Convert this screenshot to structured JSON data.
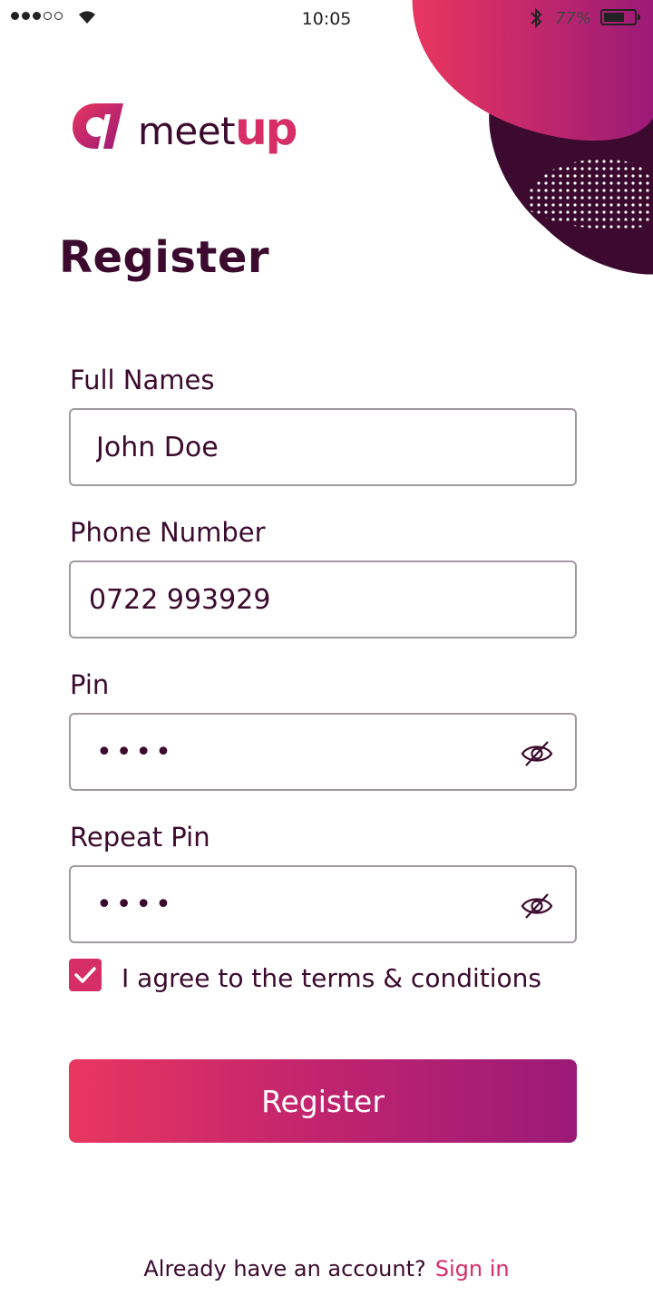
{
  "status_bar": {
    "time": "10:05",
    "battery_percent": "77%",
    "battery_level": 0.77,
    "signal_bars_filled": 3,
    "signal_bars_total": 5
  },
  "brand": {
    "name_part1": "meet",
    "name_part2": "up",
    "colors": {
      "primary": "#d62e67",
      "dark": "#3b0a2e",
      "gradient_start": "#e8365f",
      "gradient_end": "#9b1a77"
    }
  },
  "page": {
    "title": "Register"
  },
  "form": {
    "full_name": {
      "label": "Full Names",
      "value": "John Doe"
    },
    "phone": {
      "label": "Phone Number",
      "value": "0722 993929"
    },
    "pin": {
      "label": "Pin",
      "value": "••••"
    },
    "repeat_pin": {
      "label": "Repeat Pin",
      "value": "••••"
    },
    "terms": {
      "label": "I agree to the terms & conditions",
      "checked": true
    },
    "submit_label": "Register"
  },
  "footer": {
    "prompt": "Already have an account?",
    "link": "Sign in"
  },
  "icons": [
    "wifi-icon",
    "bluetooth-icon",
    "battery-icon",
    "eye-off-icon",
    "checkmark-icon",
    "logo-icon"
  ]
}
